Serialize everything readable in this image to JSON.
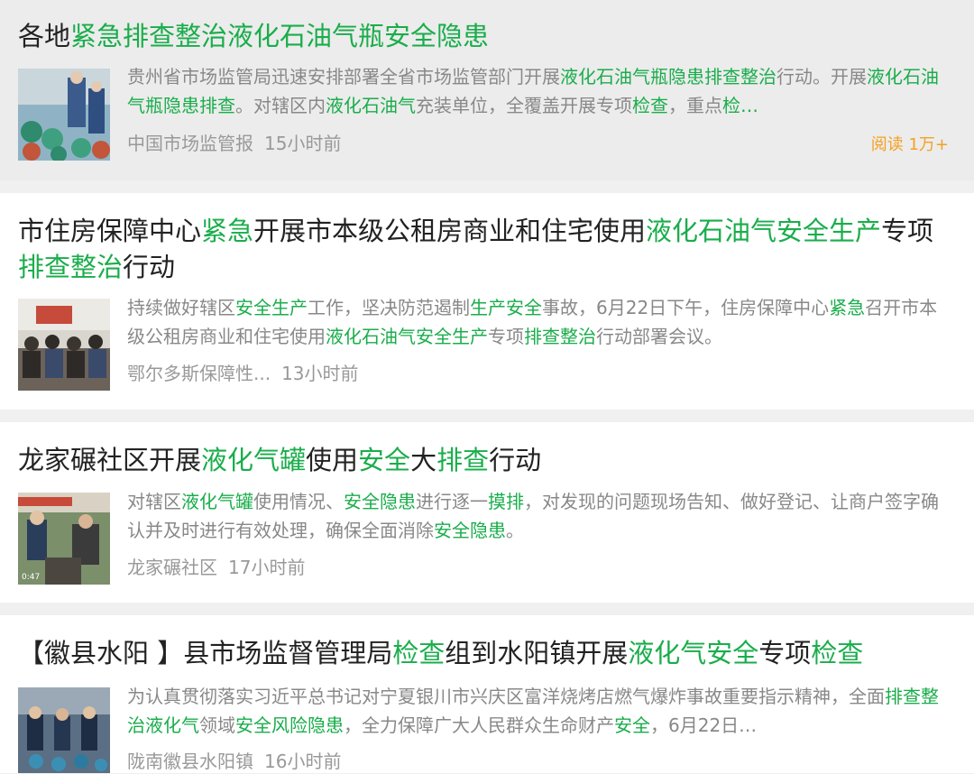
{
  "colors": {
    "highlight": "#1aad4b",
    "reads": "#f5a021",
    "snippet": "#888888",
    "meta": "#999999"
  },
  "items": [
    {
      "title": [
        {
          "t": "各地",
          "h": false
        },
        {
          "t": "紧急排查整治液化石油气瓶安全隐患",
          "h": true
        }
      ],
      "snippet": [
        {
          "t": "贵州省市场监管局迅速安排部署全省市场监管部门开展",
          "h": false
        },
        {
          "t": "液化石油气瓶隐患排查整治",
          "h": true
        },
        {
          "t": "行动。开展",
          "h": false
        },
        {
          "t": "液化石油气瓶隐患排查",
          "h": true
        },
        {
          "t": "。对辖区内",
          "h": false
        },
        {
          "t": "液化石油气",
          "h": true
        },
        {
          "t": "充装单位，全覆盖开展专项",
          "h": false
        },
        {
          "t": "检查",
          "h": true
        },
        {
          "t": "，重点",
          "h": false
        },
        {
          "t": "检…",
          "h": true
        }
      ],
      "source": "中国市场监管报",
      "time": "15小时前",
      "reads": "阅读 1万+"
    },
    {
      "title": [
        {
          "t": "市住房保障中心",
          "h": false
        },
        {
          "t": "紧急",
          "h": true
        },
        {
          "t": "开展市本级公租房商业和住宅使用",
          "h": false
        },
        {
          "t": "液化石油气安全生产",
          "h": true
        },
        {
          "t": "专项",
          "h": false
        },
        {
          "t": "排查整治",
          "h": true
        },
        {
          "t": "行动",
          "h": false
        }
      ],
      "snippet": [
        {
          "t": "持续做好辖区",
          "h": false
        },
        {
          "t": "安全生产",
          "h": true
        },
        {
          "t": "工作，坚决防范遏制",
          "h": false
        },
        {
          "t": "生产安全",
          "h": true
        },
        {
          "t": "事故，6月22日下午，住房保障中心",
          "h": false
        },
        {
          "t": "紧急",
          "h": true
        },
        {
          "t": "召开市本级公租房商业和住宅使用",
          "h": false
        },
        {
          "t": "液化石油气安全生产",
          "h": true
        },
        {
          "t": "专项",
          "h": false
        },
        {
          "t": "排查整治",
          "h": true
        },
        {
          "t": "行动部署会议。",
          "h": false
        }
      ],
      "source": "鄂尔多斯保障性...",
      "time": "13小时前"
    },
    {
      "title": [
        {
          "t": "龙家碾社区开展",
          "h": false
        },
        {
          "t": "液化气罐",
          "h": true
        },
        {
          "t": "使用",
          "h": false
        },
        {
          "t": "安全",
          "h": true
        },
        {
          "t": "大",
          "h": false
        },
        {
          "t": "排查",
          "h": true
        },
        {
          "t": "行动",
          "h": false
        }
      ],
      "snippet": [
        {
          "t": "对辖区",
          "h": false
        },
        {
          "t": "液化气罐",
          "h": true
        },
        {
          "t": "使用情况、",
          "h": false
        },
        {
          "t": "安全隐患",
          "h": true
        },
        {
          "t": "进行逐一",
          "h": false
        },
        {
          "t": "摸排",
          "h": true
        },
        {
          "t": "，对发现的问题现场告知、做好登记、让商户签字确认并及时进行有效处理，确保全面消除",
          "h": false
        },
        {
          "t": "安全隐患",
          "h": true
        },
        {
          "t": "。",
          "h": false
        }
      ],
      "source": "龙家碾社区",
      "time": "17小时前"
    },
    {
      "title": [
        {
          "t": "【徽县水阳 】县市场监督管理局",
          "h": false
        },
        {
          "t": "检查",
          "h": true
        },
        {
          "t": "组到水阳镇开展",
          "h": false
        },
        {
          "t": "液化气安全",
          "h": true
        },
        {
          "t": "专项",
          "h": false
        },
        {
          "t": "检查",
          "h": true
        }
      ],
      "snippet": [
        {
          "t": "为认真贯彻落实习近平总书记对宁夏银川市兴庆区富洋烧烤店燃气爆炸事故重要指示精神，全面",
          "h": false
        },
        {
          "t": "排查整治液化气",
          "h": true
        },
        {
          "t": "领域",
          "h": false
        },
        {
          "t": "安全风险隐患",
          "h": true
        },
        {
          "t": "，全力保障广大人民群众生命财产",
          "h": false
        },
        {
          "t": "安全",
          "h": true
        },
        {
          "t": "，6月22日…",
          "h": false
        }
      ],
      "source": "陇南徽县水阳镇",
      "time": "16小时前"
    }
  ]
}
